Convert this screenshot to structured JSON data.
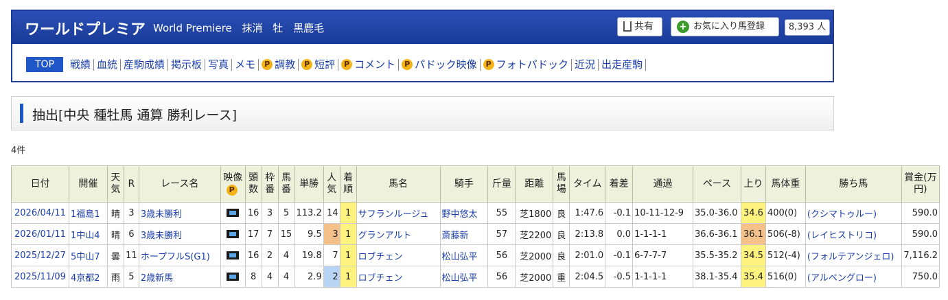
{
  "header": {
    "horse_name": "ワールドプレミア",
    "english_name": "World Premiere",
    "status": "抹消",
    "sex": "牡",
    "coat": "黒鹿毛",
    "share_label": "共有",
    "fav_label": "お気に入り馬登録",
    "fav_count": "8,393 人"
  },
  "nav": {
    "top": "TOP",
    "items": [
      {
        "label": "戦績",
        "premium": false
      },
      {
        "label": "血統",
        "premium": false
      },
      {
        "label": "産駒成績",
        "premium": false
      },
      {
        "label": "掲示板",
        "premium": false
      },
      {
        "label": "写真",
        "premium": false
      },
      {
        "label": "メモ",
        "premium": false
      },
      {
        "label": "調教",
        "premium": true
      },
      {
        "label": "短評",
        "premium": true
      },
      {
        "label": "コメント",
        "premium": true
      },
      {
        "label": "パドック映像",
        "premium": true
      },
      {
        "label": "フォトパドック",
        "premium": true
      },
      {
        "label": "近況",
        "premium": false
      },
      {
        "label": "出走産駒",
        "premium": false
      }
    ],
    "premium_badge": "P"
  },
  "section": {
    "title": "抽出[中央 種牡馬 通算 勝利レース]",
    "count": "4件"
  },
  "table": {
    "headers": {
      "date": "日付",
      "venue": "開催",
      "weather": "天気",
      "r": "R",
      "race": "レース名",
      "video": "映像",
      "heads": "頭数",
      "waku": "枠番",
      "uma": "馬番",
      "odds": "単勝",
      "pop": "人気",
      "finish": "着順",
      "horse": "馬名",
      "jockey": "騎手",
      "weight": "斤量",
      "dist": "距離",
      "track": "馬場",
      "time": "タイム",
      "margin": "着差",
      "pass": "通過",
      "pace": "ペース",
      "last": "上り",
      "bw": "馬体重",
      "winner": "勝ち馬",
      "prize": "賞金(万円)"
    },
    "rows": [
      {
        "date": "2026/04/11",
        "venue": "1福島1",
        "weather": "晴",
        "r": "3",
        "race": "3歳未勝利",
        "heads": "16",
        "waku": "3",
        "uma": "5",
        "odds": "113.2",
        "pop": "14",
        "finish": "1",
        "horse": "サフランルージュ",
        "jockey": "野中悠太",
        "weight": "55",
        "dist": "芝1800",
        "track": "良",
        "time": "1:47.6",
        "margin": "-0.1",
        "pass": "10-11-12-9",
        "pace": "35.0-36.0",
        "last": "34.6",
        "bw": "400(0)",
        "winner": "(クシマトゥルー)",
        "prize": "590.0"
      },
      {
        "date": "2026/01/11",
        "venue": "1中山4",
        "weather": "晴",
        "r": "6",
        "race": "3歳未勝利",
        "heads": "17",
        "waku": "7",
        "uma": "15",
        "odds": "9.5",
        "pop": "3",
        "finish": "1",
        "horse": "グランアルト",
        "jockey": "斎藤新",
        "weight": "57",
        "dist": "芝2200",
        "track": "良",
        "time": "2:13.8",
        "margin": "0.0",
        "pass": "1-1-1-1",
        "pace": "36.6-36.1",
        "last": "36.1",
        "bw": "506(-8)",
        "winner": "(レイヒストリコ)",
        "prize": "590.0"
      },
      {
        "date": "2025/12/27",
        "venue": "5中山7",
        "weather": "曇",
        "r": "11",
        "race": "ホープフルS(G1)",
        "heads": "16",
        "waku": "2",
        "uma": "4",
        "odds": "19.8",
        "pop": "7",
        "finish": "1",
        "horse": "ロブチェン",
        "jockey": "松山弘平",
        "weight": "56",
        "dist": "芝2000",
        "track": "良",
        "time": "2:01.0",
        "margin": "-0.1",
        "pass": "6-7-7-7",
        "pace": "35.5-35.2",
        "last": "34.5",
        "bw": "512(-4)",
        "winner": "(フォルテアンジェロ)",
        "prize": "7,116.2"
      },
      {
        "date": "2025/11/09",
        "venue": "4京都2",
        "weather": "雨",
        "r": "5",
        "race": "2歳新馬",
        "heads": "8",
        "waku": "4",
        "uma": "4",
        "odds": "2.9",
        "pop": "2",
        "finish": "1",
        "horse": "ロブチェン",
        "jockey": "松山弘平",
        "weight": "56",
        "dist": "芝2000",
        "track": "重",
        "time": "2:04.5",
        "margin": "-0.5",
        "pass": "1-1-1-1",
        "pace": "38.1-35.4",
        "last": "35.4",
        "bw": "516(0)",
        "winner": "(アルベングロー)",
        "prize": "750.0"
      }
    ]
  },
  "colors": {
    "header_blue": "#1b3c9a",
    "nav_link": "#1a3ea8",
    "first_place": "#fff380",
    "last_3f_best": "#f5c18a",
    "pop_2": "#b8d4f5",
    "table_header": "#eef1dc"
  }
}
